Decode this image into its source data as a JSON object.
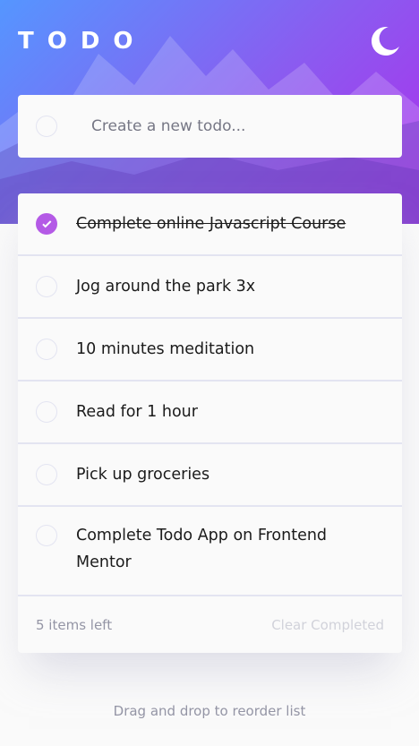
{
  "app": {
    "title": "TODO",
    "theme_icon": "moon-icon"
  },
  "new_todo": {
    "placeholder": "Create a new todo..."
  },
  "todos": [
    {
      "text": "Complete online Javascript Course",
      "completed": true
    },
    {
      "text": "Jog around the park 3x",
      "completed": false
    },
    {
      "text": "10 minutes meditation",
      "completed": false
    },
    {
      "text": "Read for 1 hour",
      "completed": false
    },
    {
      "text": "Pick up groceries",
      "completed": false
    },
    {
      "text": "Complete Todo App on Frontend Mentor",
      "completed": false
    }
  ],
  "footer": {
    "items_left": "5 items left",
    "clear_label": "Clear Completed"
  },
  "hint": "Drag and drop to reorder list",
  "colors": {
    "accent": "#b45ae6",
    "gradient_start": "#5596ff",
    "gradient_end": "#ac2dec",
    "background": "#fafafa",
    "text": "#1b1b1b",
    "muted": "#9495a5",
    "border": "#e3e4f1"
  }
}
